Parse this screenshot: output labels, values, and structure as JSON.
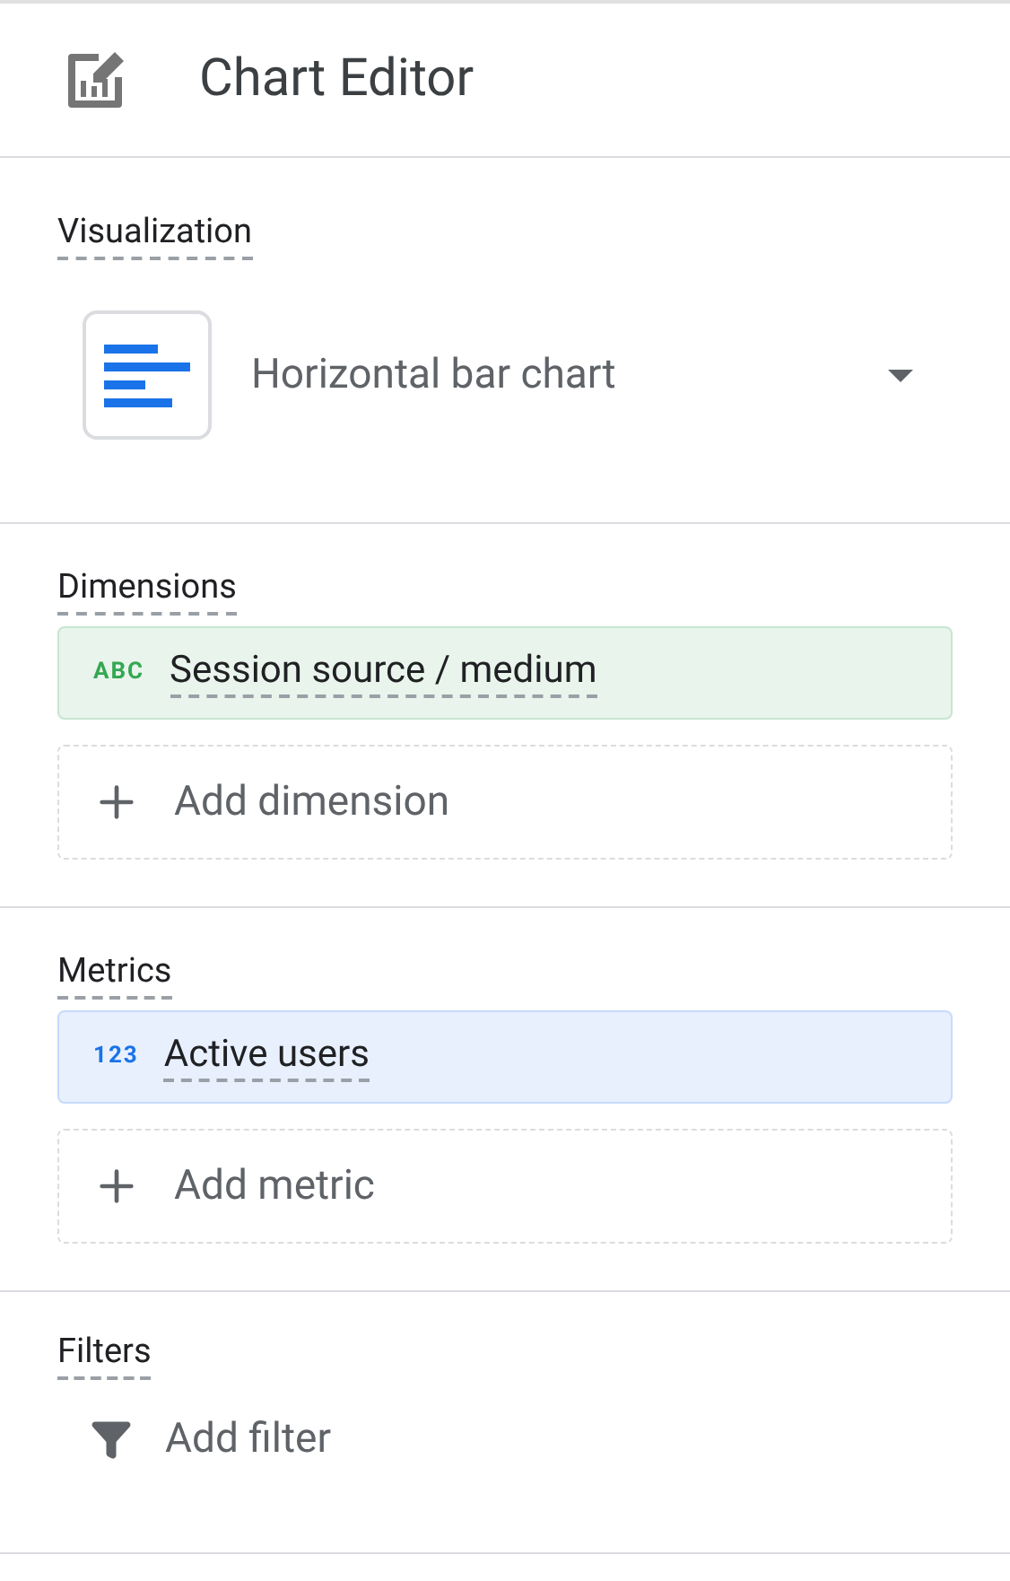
{
  "header": {
    "title": "Chart Editor"
  },
  "visualization": {
    "label": "Visualization",
    "value": "Horizontal bar chart"
  },
  "sections": [
    {
      "label": "Dimensions",
      "items": [
        {
          "kind": "dimension",
          "badge": "ABC",
          "name": "Session source / medium"
        }
      ],
      "add": "Add dimension"
    },
    {
      "label": "Metrics",
      "items": [
        {
          "kind": "metric",
          "badge": "123",
          "name": "Active users"
        }
      ],
      "add": "Add metric"
    }
  ],
  "filters": {
    "label": "Filters",
    "add": "Add filter"
  }
}
